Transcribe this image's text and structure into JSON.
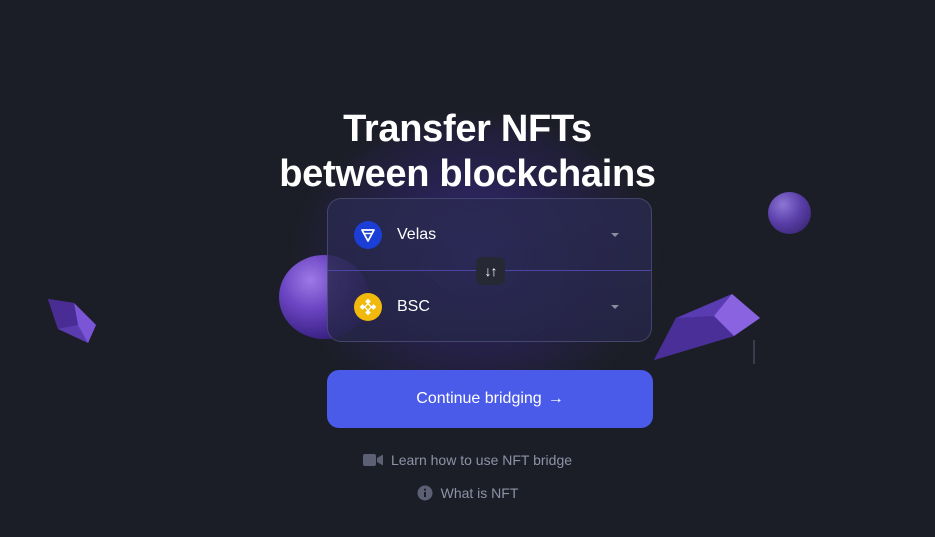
{
  "hero": {
    "title_line1": "Transfer NFTs",
    "title_line2": "between blockchains"
  },
  "bridge": {
    "from_chain": {
      "name": "Velas",
      "icon": "velas-logo-icon"
    },
    "to_chain": {
      "name": "BSC",
      "icon": "bsc-logo-icon"
    },
    "swap_icon": "swap-arrows-icon",
    "swap_glyph": "↓↑"
  },
  "cta": {
    "label": "Continue bridging",
    "arrow": "→"
  },
  "links": {
    "learn": "Learn how to use NFT bridge",
    "what": "What is NFT"
  },
  "colors": {
    "background": "#1c1e27",
    "accent": "#4a5ae9",
    "velas": "#1b3fd6",
    "bsc": "#f0b90b",
    "muted_text": "#8e92a8"
  }
}
